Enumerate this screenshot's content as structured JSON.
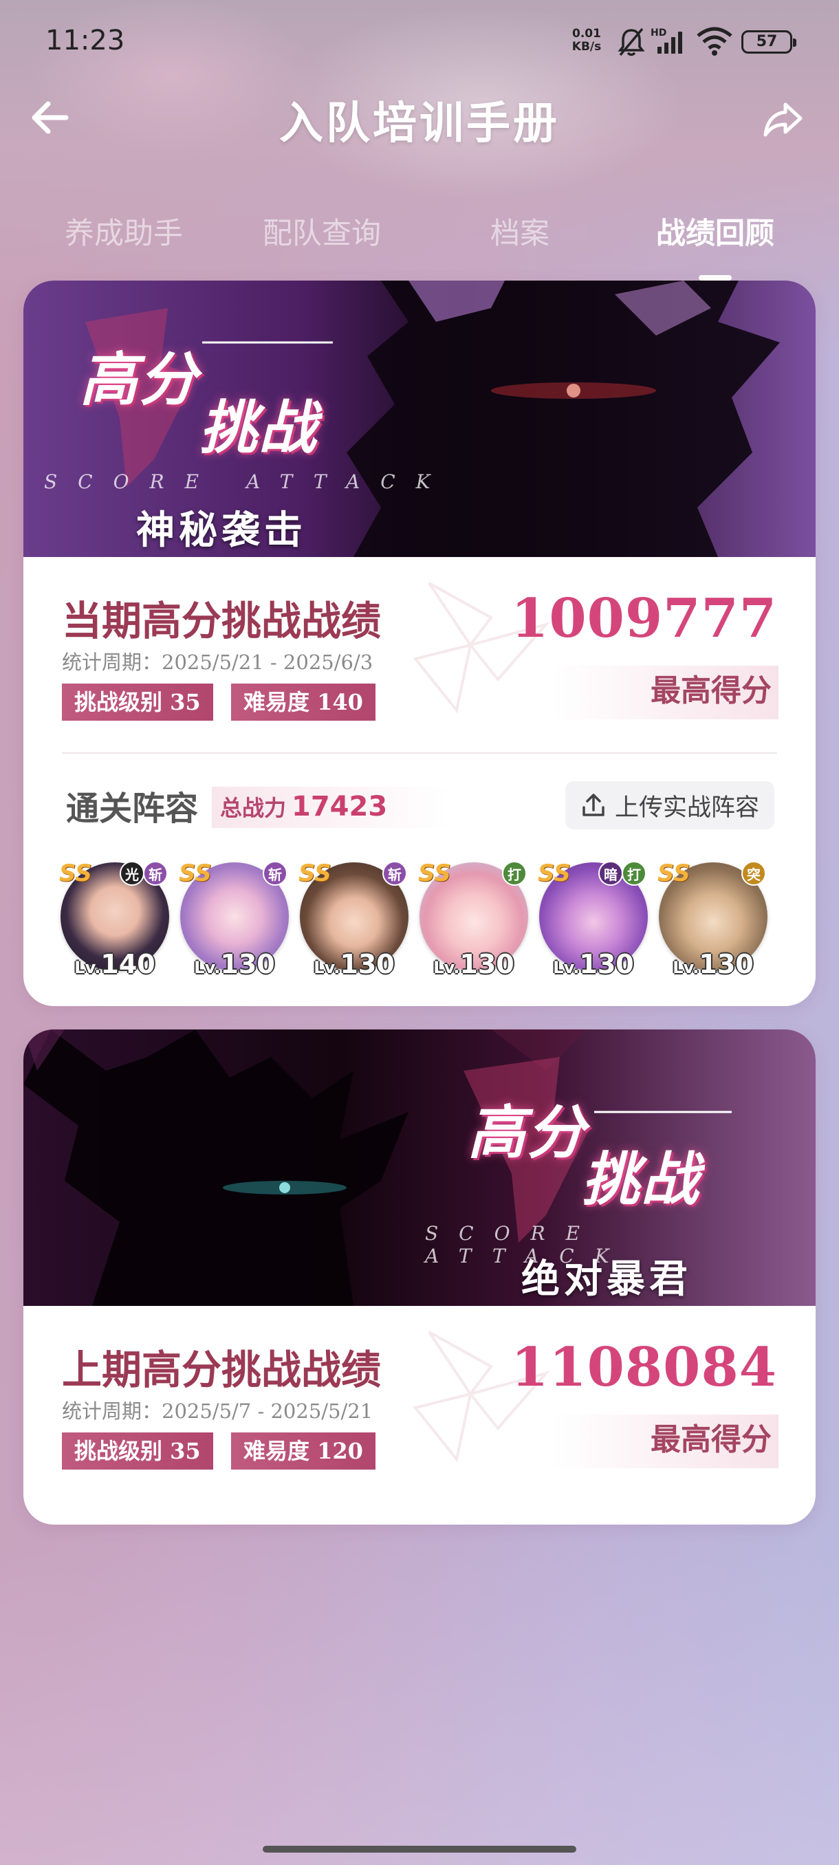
{
  "status_bar": {
    "time": "11:23",
    "network_speed": "0.01",
    "network_unit": "KB/s",
    "battery": "57"
  },
  "header": {
    "title": "入队培训手册"
  },
  "tabs": [
    {
      "label": "养成助手",
      "active": false
    },
    {
      "label": "配队查询",
      "active": false
    },
    {
      "label": "档案",
      "active": false
    },
    {
      "label": "战绩回顾",
      "active": true
    }
  ],
  "current": {
    "banner_title_1": "高分",
    "banner_title_2": "挑战",
    "banner_en": "SCORE ATTACK",
    "banner_sub": "神秘袭击",
    "heading": "当期高分挑战战绩",
    "period": "统计周期：2025/5/21 - 2025/6/3",
    "challenge_level": "挑战级别 35",
    "difficulty": "难易度 140",
    "score": "1009777",
    "score_label": "最高得分",
    "team_title": "通关阵容",
    "power_label": "总战力",
    "power_value": "17423",
    "upload_label": "上传实战阵容",
    "members": [
      {
        "rank": "SS",
        "attrs": [
          "光",
          "斩"
        ],
        "level": "140"
      },
      {
        "rank": "SS",
        "attrs": [
          "斩"
        ],
        "level": "130"
      },
      {
        "rank": "SS",
        "attrs": [
          "斩"
        ],
        "level": "130"
      },
      {
        "rank": "SS",
        "attrs": [
          "打"
        ],
        "level": "130"
      },
      {
        "rank": "SS",
        "attrs": [
          "暗",
          "打"
        ],
        "level": "130"
      },
      {
        "rank": "SS",
        "attrs": [
          "突"
        ],
        "level": "130"
      }
    ]
  },
  "previous": {
    "banner_title_1": "高分",
    "banner_title_2": "挑战",
    "banner_en": "SCORE ATTACK",
    "banner_sub": "绝对暴君",
    "heading": "上期高分挑战战绩",
    "period": "统计周期：2025/5/7 - 2025/5/21",
    "challenge_level": "挑战级别 35",
    "difficulty": "难易度 120",
    "score": "1108084",
    "score_label": "最高得分"
  },
  "level_prefix": "Lv.",
  "colors": {
    "accent": "#d4467b",
    "chip": "#b2466d",
    "heading": "#9b3a55"
  }
}
